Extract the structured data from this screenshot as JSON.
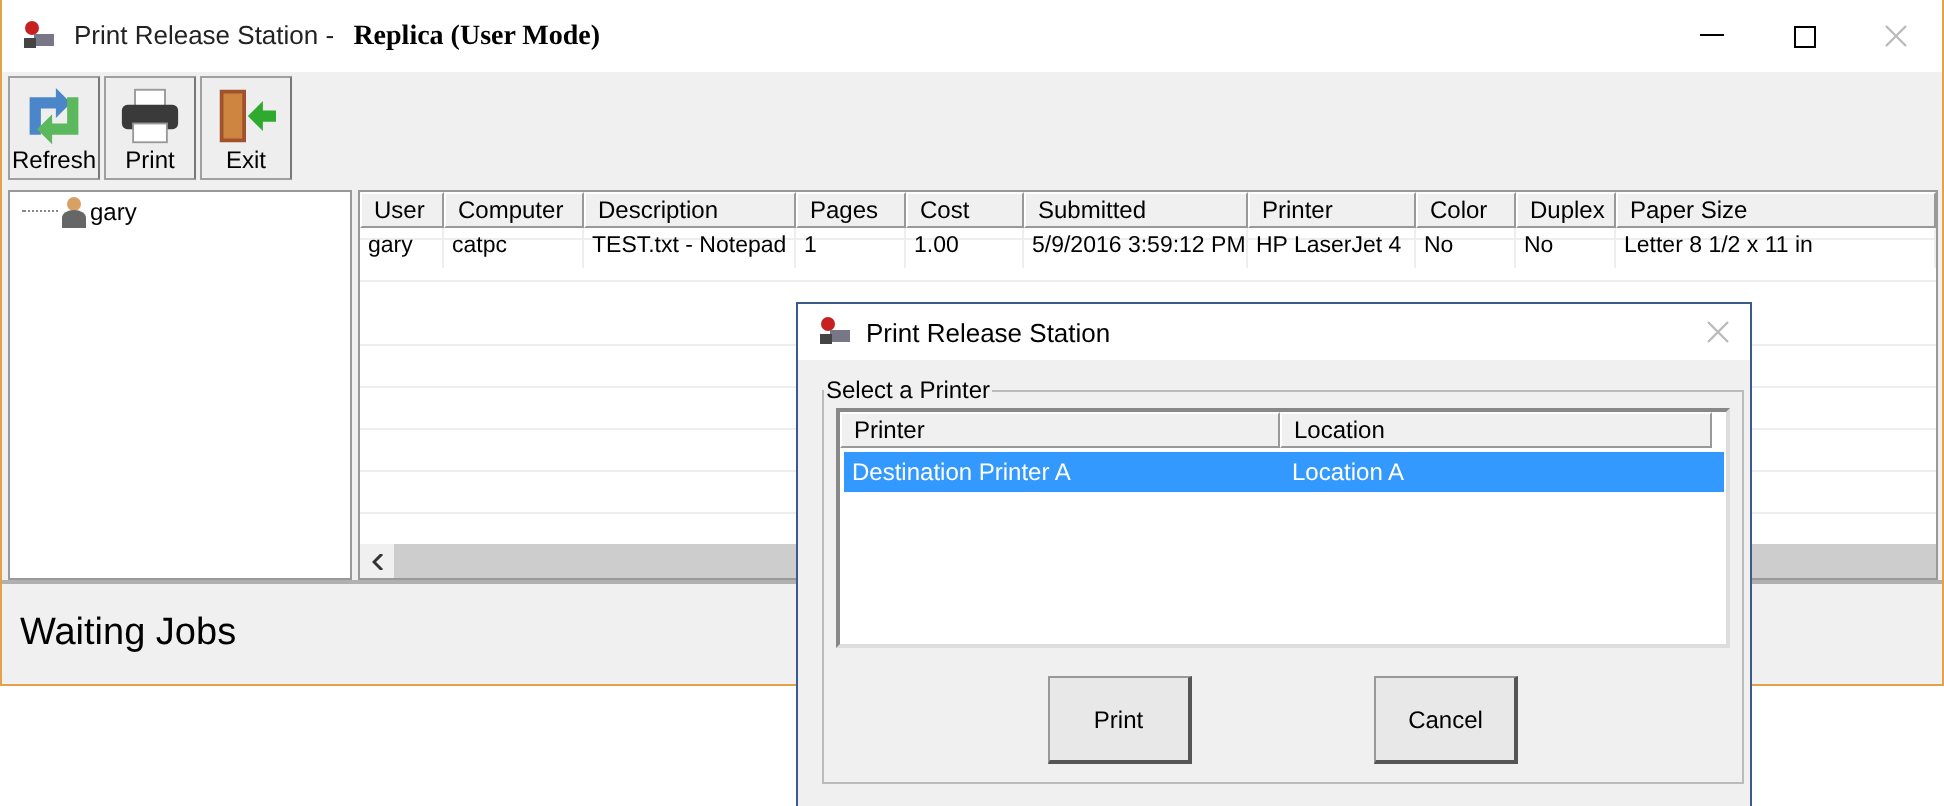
{
  "window": {
    "title": "Print Release Station - **Replica (User Mode)**"
  },
  "toolbar": [
    {
      "label": "Refresh",
      "kind": "refresh"
    },
    {
      "label": "Print",
      "kind": "print"
    },
    {
      "label": "Exit",
      "kind": "exit"
    }
  ],
  "tree": {
    "items": [
      {
        "label": "gary"
      }
    ]
  },
  "jobs": {
    "columns": [
      "User",
      "Computer",
      "Description",
      "Pages",
      "Cost",
      "Submitted",
      "Printer",
      "Color",
      "Duplex",
      "Paper Size"
    ],
    "rows": [
      [
        "gary",
        "catpc",
        "TEST.txt - Notepad",
        "1",
        "1.00",
        "5/9/2016 3:59:12 PM",
        "HP LaserJet 4",
        "No",
        "No",
        "Letter 8 1/2 x 11 in"
      ]
    ]
  },
  "status_bar": "Waiting Jobs",
  "dialog": {
    "title": "Print Release Station",
    "group_label": "Select a Printer",
    "columns": [
      "Printer",
      "Location"
    ],
    "rows": [
      {
        "cells": [
          "Destination Printer A",
          "Location A"
        ],
        "selected": true
      }
    ],
    "buttons": [
      "Print",
      "Cancel"
    ]
  }
}
